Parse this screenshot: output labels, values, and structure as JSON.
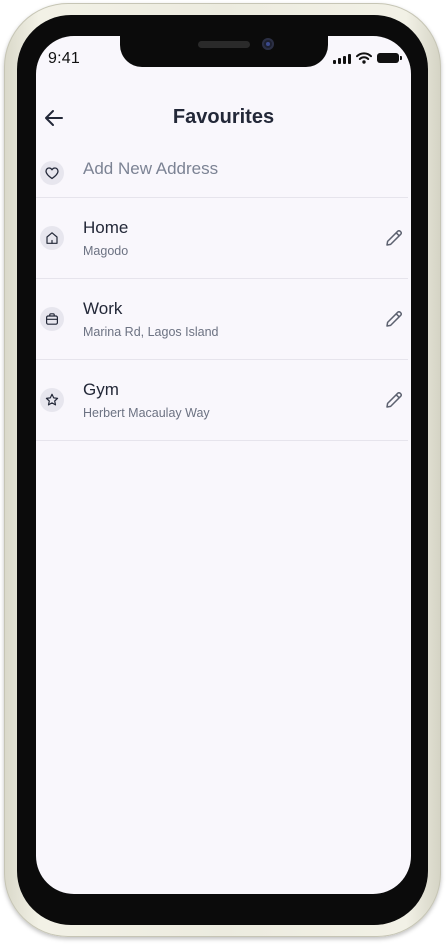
{
  "status_bar": {
    "time": "9:41"
  },
  "header": {
    "title": "Favourites"
  },
  "add_address": {
    "label": "Add New Address",
    "icon": "heart-icon"
  },
  "favourites": [
    {
      "name": "Home",
      "address": "Magodo",
      "icon": "home-icon"
    },
    {
      "name": "Work",
      "address": "Marina Rd, Lagos Island",
      "icon": "briefcase-icon"
    },
    {
      "name": "Gym",
      "address": "Herbert Macaulay Way",
      "icon": "star-icon"
    }
  ],
  "colors": {
    "screen_background": "#f9f7fc",
    "title_text": "#232838",
    "secondary_text": "#6c7282",
    "icon_background": "#e7e6ee",
    "divider": "#e6e4ec"
  }
}
